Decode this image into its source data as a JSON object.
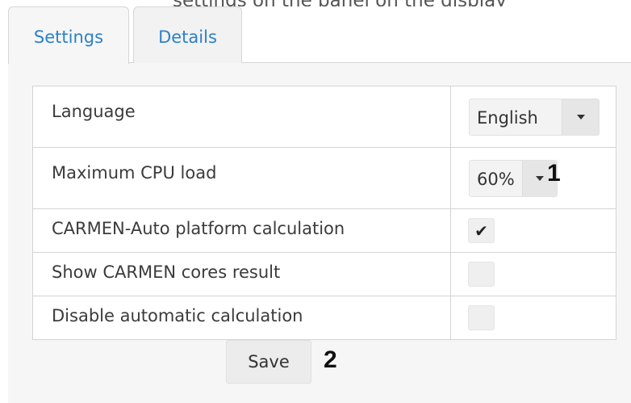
{
  "caption": {
    "text": "settings on the panel on the display"
  },
  "tabs": [
    {
      "label": "Settings",
      "active": true
    },
    {
      "label": "Details",
      "active": false
    }
  ],
  "settings": {
    "rows": [
      {
        "label": "Language",
        "control": "select",
        "value": "English"
      },
      {
        "label": "Maximum CPU load",
        "control": "select",
        "value": "60%"
      },
      {
        "label": "CARMEN-Auto platform calculation",
        "control": "checkbox",
        "checked": true,
        "check_glyph": "✔"
      },
      {
        "label": "Show CARMEN cores result",
        "control": "checkbox",
        "checked": false
      },
      {
        "label": "Disable automatic calculation",
        "control": "checkbox",
        "checked": false
      }
    ]
  },
  "save_button": {
    "label": "Save"
  },
  "annotations": {
    "cpu_marker": "1",
    "save_marker": "2"
  },
  "colors": {
    "tab_text": "#2b82c9",
    "panel_background": "#f6f6f6",
    "border": "#d4d4d4",
    "control_background": "#f3f3f3"
  },
  "icons": {
    "dropdown": "caret-down-icon",
    "check": "checkmark-icon"
  }
}
